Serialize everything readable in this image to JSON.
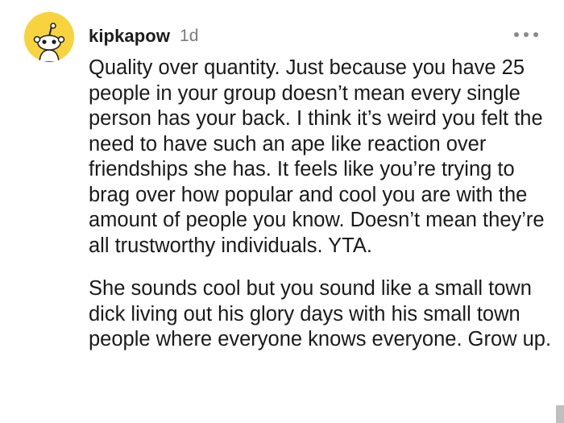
{
  "comment": {
    "author": "kipkapow",
    "age": "1d",
    "avatar_icon": "reddit-snoo-avatar-icon",
    "avatar_color": "#f7d33e",
    "more_icon": "more-options-icon",
    "paragraphs": [
      "Quality over quantity. Just because you have 25 people in your group doesn’t mean every single person has your back. I think it’s weird you felt the need to have such an ape like reaction over friendships she has. It feels like you’re trying to brag over how popular and cool you are with the amount of people you know. Doesn’t mean they’re all trustworthy individuals. YTA.",
      "She sounds cool but you sound like a small town dick living out his glory days with his small town people where everyone knows everyone. Grow up."
    ]
  }
}
